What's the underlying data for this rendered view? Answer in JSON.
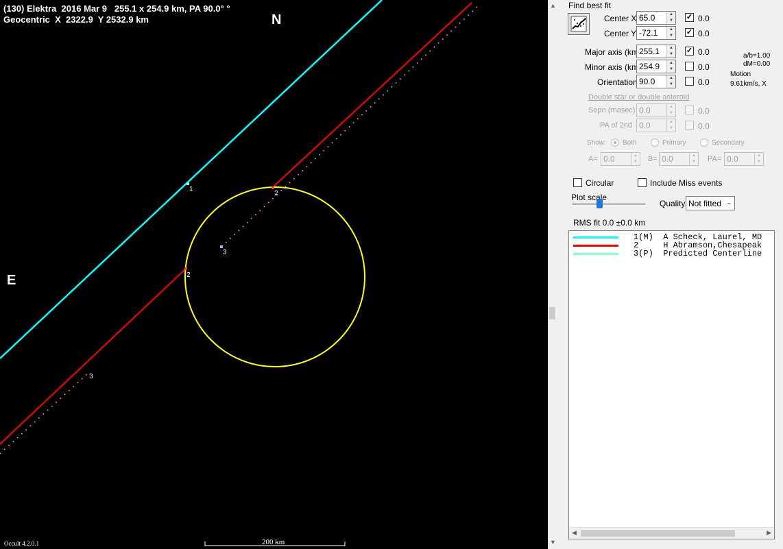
{
  "plot": {
    "header_line1": "(130) Elektra  2016 Mar 9   255.1 x 254.9 km, PA 90.0° °",
    "header_line2": "Geocentric  X  2322.9  Y 2532.9 km",
    "north_label": "N",
    "east_label": "E",
    "version": "Occult 4.2.0.1",
    "scale_label": "200 km",
    "chord_labels": {
      "cyan_1": "1",
      "red_top_2": "2",
      "red_top_dot_3": "3",
      "red_bottom_2": "2",
      "red_bottom_3": "3"
    },
    "colors": {
      "background": "#000000",
      "ellipse": "#ffff00",
      "chord1": "#00ffff",
      "chord2": "#ff0000",
      "dots": "#ff7f9f"
    }
  },
  "panel": {
    "find_best_fit": "Find best fit",
    "find_icon": "chart-fit-icon",
    "center_x": {
      "label": "Center X",
      "value": "65.0",
      "checked": true,
      "result": "0.0"
    },
    "center_y": {
      "label": "Center Y",
      "value": "-72.1",
      "checked": true,
      "result": "0.0"
    },
    "major_axis": {
      "label": "Major axis (km)",
      "value": "255.1",
      "checked": true,
      "result": "0.0"
    },
    "minor_axis": {
      "label": "Minor axis (km)",
      "value": "254.9",
      "checked": false,
      "result": "0.0"
    },
    "orientation": {
      "label": "Orientation",
      "value": "90.0",
      "checked": false,
      "result": "0.0"
    },
    "ab_ratio": "a/b=1.00",
    "dm": "dM=0.00",
    "motion_label": "Motion",
    "motion_value": "9.61km/s, X",
    "double_star_link": "Double star  or  double asteroid",
    "sepn": {
      "label": "Sepn (masec)",
      "value": "0.0",
      "result": "0.0"
    },
    "pa2nd": {
      "label": "PA of 2nd",
      "value": "0.0",
      "result": "0.0"
    },
    "show_label": "Show:",
    "show_options": [
      "Both",
      "Primary",
      "Secondary"
    ],
    "show_selected": "Both",
    "a_eq": {
      "label": "A=",
      "value": "0.0"
    },
    "b_eq": {
      "label": "B=",
      "value": "0.0"
    },
    "pa_eq": {
      "label": "PA=",
      "value": "0.0"
    },
    "circular_label": "Circular",
    "include_miss_label": "Include Miss events",
    "plot_scale_label": "Plot scale",
    "quality_label": "Quality",
    "quality_value": "Not fitted",
    "rms_fit": "RMS fit  0.0 ±0.0 km",
    "legend": [
      {
        "color": "#00ffff",
        "text": "1(M)  A Scheck, Laurel, MD"
      },
      {
        "color": "#ff0000",
        "text": "2     H Abramson,Chesapeak"
      },
      {
        "color": "#7fffd4",
        "text": "3(P)  Predicted Centerline"
      }
    ]
  }
}
